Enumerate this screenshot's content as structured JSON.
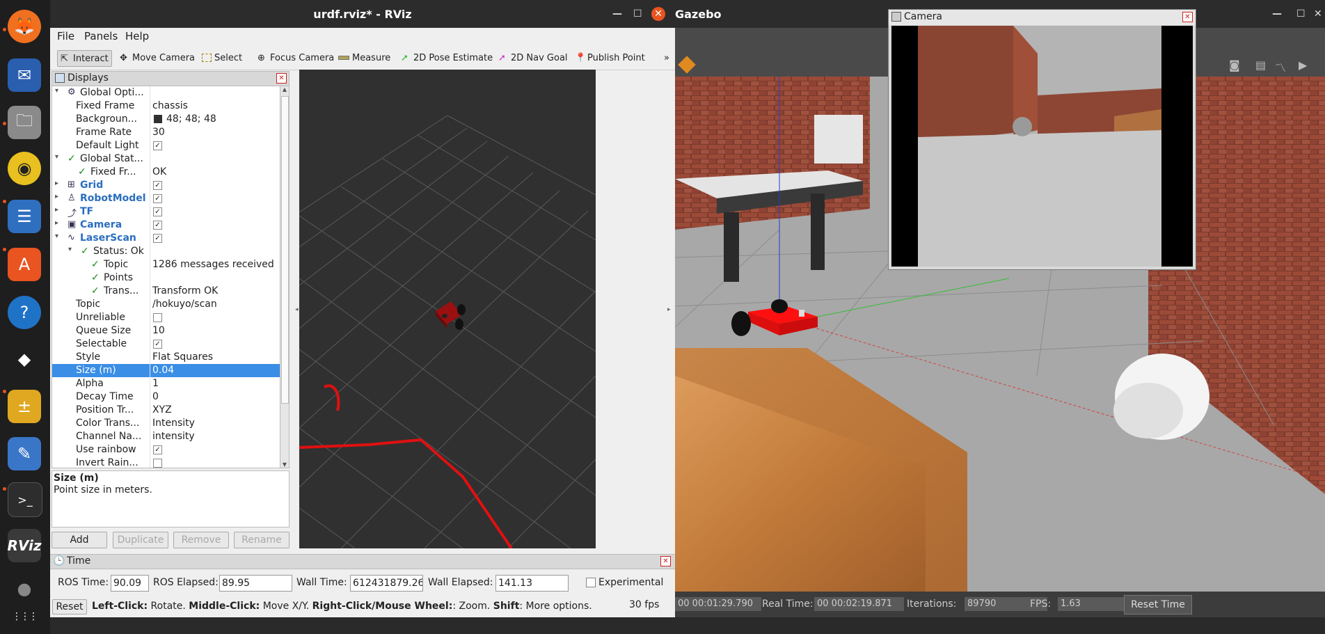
{
  "dock": {
    "items": [
      {
        "name": "firefox-icon",
        "glyph": "🦊"
      },
      {
        "name": "thunderbird-icon",
        "glyph": "✉"
      },
      {
        "name": "files-icon",
        "glyph": "🗀"
      },
      {
        "name": "rhythmbox-icon",
        "glyph": "◉"
      },
      {
        "name": "writer-icon",
        "glyph": "☰"
      },
      {
        "name": "software-icon",
        "glyph": "A"
      },
      {
        "name": "help-icon",
        "glyph": "?"
      },
      {
        "name": "app-icon",
        "glyph": "◆"
      },
      {
        "name": "calculator-icon",
        "glyph": "±"
      },
      {
        "name": "text-editor-icon",
        "glyph": "✎"
      },
      {
        "name": "terminal-icon",
        "glyph": ">_"
      },
      {
        "name": "rviz-icon",
        "glyph": "RViz"
      },
      {
        "name": "disc-icon",
        "glyph": "●"
      },
      {
        "name": "show-apps-icon",
        "glyph": "⋮⋮⋮"
      }
    ]
  },
  "rviz": {
    "title": "urdf.rviz* - RViz",
    "menu": [
      "File",
      "Panels",
      "Help"
    ],
    "tools": [
      "Interact",
      "Move Camera",
      "Select",
      "Focus Camera",
      "Measure",
      "2D Pose Estimate",
      "2D Nav Goal",
      "Publish Point"
    ],
    "more": "»",
    "displays": {
      "title": "Displays",
      "rows": [
        {
          "indent": 0,
          "arrow": "▾",
          "icon": "⚙",
          "name": "Global Opti...",
          "value": ""
        },
        {
          "indent": 1,
          "name": "Fixed Frame",
          "value": "chassis"
        },
        {
          "indent": 1,
          "name": "Backgroun...",
          "value": "48; 48; 48",
          "swatch": "#303030"
        },
        {
          "indent": 1,
          "name": "Frame Rate",
          "value": "30"
        },
        {
          "indent": 1,
          "name": "Default Light",
          "check": "✓"
        },
        {
          "indent": 0,
          "arrow": "▾",
          "ok": "✓",
          "name": "Global Stat...",
          "value": ""
        },
        {
          "indent": 1,
          "ok": "✓",
          "name": "Fixed Fr...",
          "value": "OK"
        },
        {
          "indent": 0,
          "arrow": "▸",
          "icon": "⊞",
          "name": "Grid",
          "blue": true,
          "check": "✓"
        },
        {
          "indent": 0,
          "arrow": "▸",
          "icon": "♙",
          "name": "RobotModel",
          "blue": true,
          "check": "✓"
        },
        {
          "indent": 0,
          "arrow": "▸",
          "icon": "⤴",
          "name": "TF",
          "blue": true,
          "check": "✓"
        },
        {
          "indent": 0,
          "arrow": "▸",
          "icon": "▣",
          "name": "Camera",
          "blue": true,
          "check": "✓"
        },
        {
          "indent": 0,
          "arrow": "▾",
          "icon": "∿",
          "name": "LaserScan",
          "blue": true,
          "check": "✓"
        },
        {
          "indent": 1,
          "arrow": "▾",
          "ok": "✓",
          "name": "Status: Ok",
          "value": ""
        },
        {
          "indent": 2,
          "ok": "✓",
          "name": "Topic",
          "value": "1286 messages received"
        },
        {
          "indent": 2,
          "ok": "✓",
          "name": "Points",
          "value": ""
        },
        {
          "indent": 2,
          "ok": "✓",
          "name": "Trans...",
          "value": "Transform OK"
        },
        {
          "indent": 1,
          "name": "Topic",
          "value": "/hokuyo/scan"
        },
        {
          "indent": 1,
          "name": "Unreliable",
          "check": ""
        },
        {
          "indent": 1,
          "name": "Queue Size",
          "value": "10"
        },
        {
          "indent": 1,
          "name": "Selectable",
          "check": "✓"
        },
        {
          "indent": 1,
          "name": "Style",
          "value": "Flat Squares"
        },
        {
          "indent": 1,
          "name": "Size (m)",
          "value": "0.04",
          "selected": true
        },
        {
          "indent": 1,
          "name": "Alpha",
          "value": "1"
        },
        {
          "indent": 1,
          "name": "Decay Time",
          "value": "0"
        },
        {
          "indent": 1,
          "name": "Position Tr...",
          "value": "XYZ"
        },
        {
          "indent": 1,
          "name": "Color Trans...",
          "value": "Intensity"
        },
        {
          "indent": 1,
          "name": "Channel Na...",
          "value": "intensity"
        },
        {
          "indent": 1,
          "name": "Use rainbow",
          "check": "✓"
        },
        {
          "indent": 1,
          "name": "Invert Rain...",
          "check": ""
        }
      ],
      "desc_title": "Size (m)",
      "desc_text": "Point size in meters.",
      "buttons": [
        "Add",
        "Duplicate",
        "Remove",
        "Rename"
      ]
    },
    "time": {
      "title": "Time",
      "ros_time_label": "ROS Time:",
      "ros_time": "90.09",
      "ros_elapsed_label": "ROS Elapsed:",
      "ros_elapsed": "89.95",
      "wall_time_label": "Wall Time:",
      "wall_time": "612431879.26",
      "wall_elapsed_label": "Wall Elapsed:",
      "wall_elapsed": "141.13",
      "experimental": "Experimental",
      "reset": "Reset",
      "hint_b1": "Left-Click:",
      "hint_t1": " Rotate. ",
      "hint_b2": "Middle-Click:",
      "hint_t2": " Move X/Y. ",
      "hint_b3": "Right-Click/Mouse Wheel:",
      "hint_t3": ": Zoom. ",
      "hint_b4": "Shift",
      "hint_t4": ": More options.",
      "fps": "30 fps"
    }
  },
  "gazebo": {
    "title": "Gazebo",
    "sim_time": "00 00:01:29.790",
    "real_time_label": "Real Time:",
    "real_time": "00 00:02:19.871",
    "iterations_label": "Iterations:",
    "iterations": "89790",
    "fps_label": "FPS:",
    "fps": "1.63",
    "reset_time": "Reset Time"
  },
  "camera_window": {
    "title": "Camera",
    "close": "✕"
  },
  "colors": {
    "selection": "#3a8ee6",
    "laser": "#e01010",
    "robot": "#b01818",
    "ubuntu_orange": "#e95420"
  }
}
